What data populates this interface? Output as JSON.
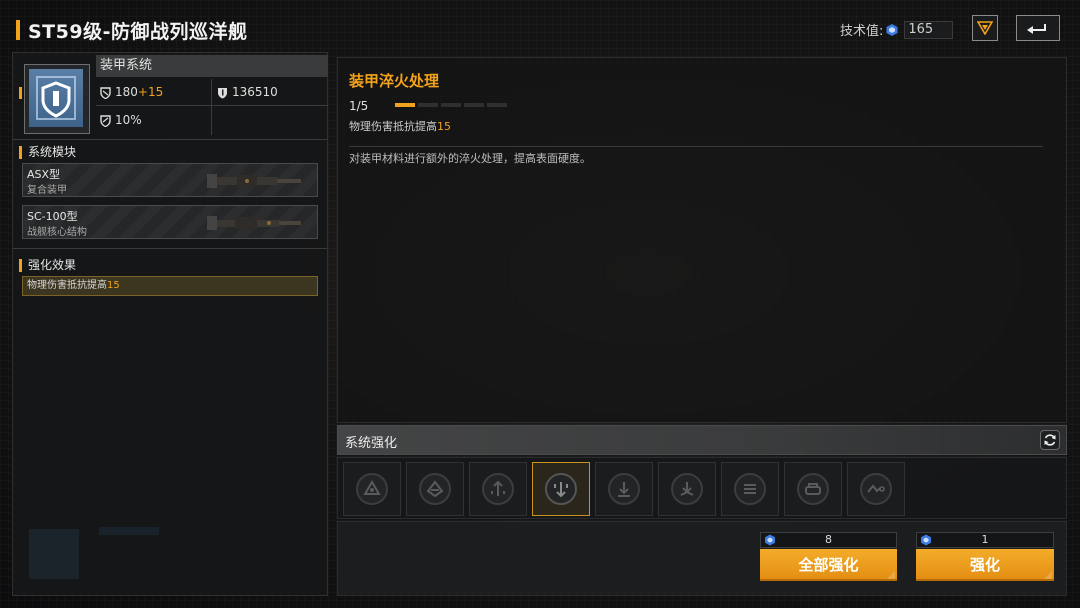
{
  "header": {
    "title": "ST59级-防御战列巡洋舰",
    "tech_label": "技术值:",
    "tech_value": "165"
  },
  "armor": {
    "name": "装甲系统",
    "stat1_base": "180",
    "stat1_bonus": "+15",
    "stat2": "136510",
    "stat3": "10%"
  },
  "modules": {
    "label": "系统模块",
    "items": [
      {
        "title": "ASX型",
        "sub": "复合装甲"
      },
      {
        "title": "SC-100型",
        "sub": "战舰核心结构"
      }
    ]
  },
  "effects": {
    "label": "强化效果",
    "line_text": "物理伤害抵抗提高",
    "line_value": "15"
  },
  "upgrade": {
    "title": "装甲淬火处理",
    "level": "1/5",
    "level_current": 1,
    "level_max": 5,
    "effect_text": "物理伤害抵抗提高",
    "effect_value": "15",
    "description": "对装甲材料进行额外的淬火处理，提高表面硬度。"
  },
  "system_upgrade": {
    "label": "系统强化",
    "selected_index": 3,
    "icons": [
      "triangle-shield-icon",
      "diamond-shield-icon",
      "arrow-up-shield-icon",
      "arrow-down-shield-icon",
      "arrow-down-circle-icon",
      "arrow-down-spread-icon",
      "stripes-icon",
      "tank-icon",
      "wave-icon"
    ]
  },
  "actions": {
    "all_cost": "8",
    "all_label": "全部强化",
    "one_cost": "1",
    "one_label": "强化"
  },
  "colors": {
    "accent": "#f2a21b",
    "currency": "#3d7be0"
  }
}
